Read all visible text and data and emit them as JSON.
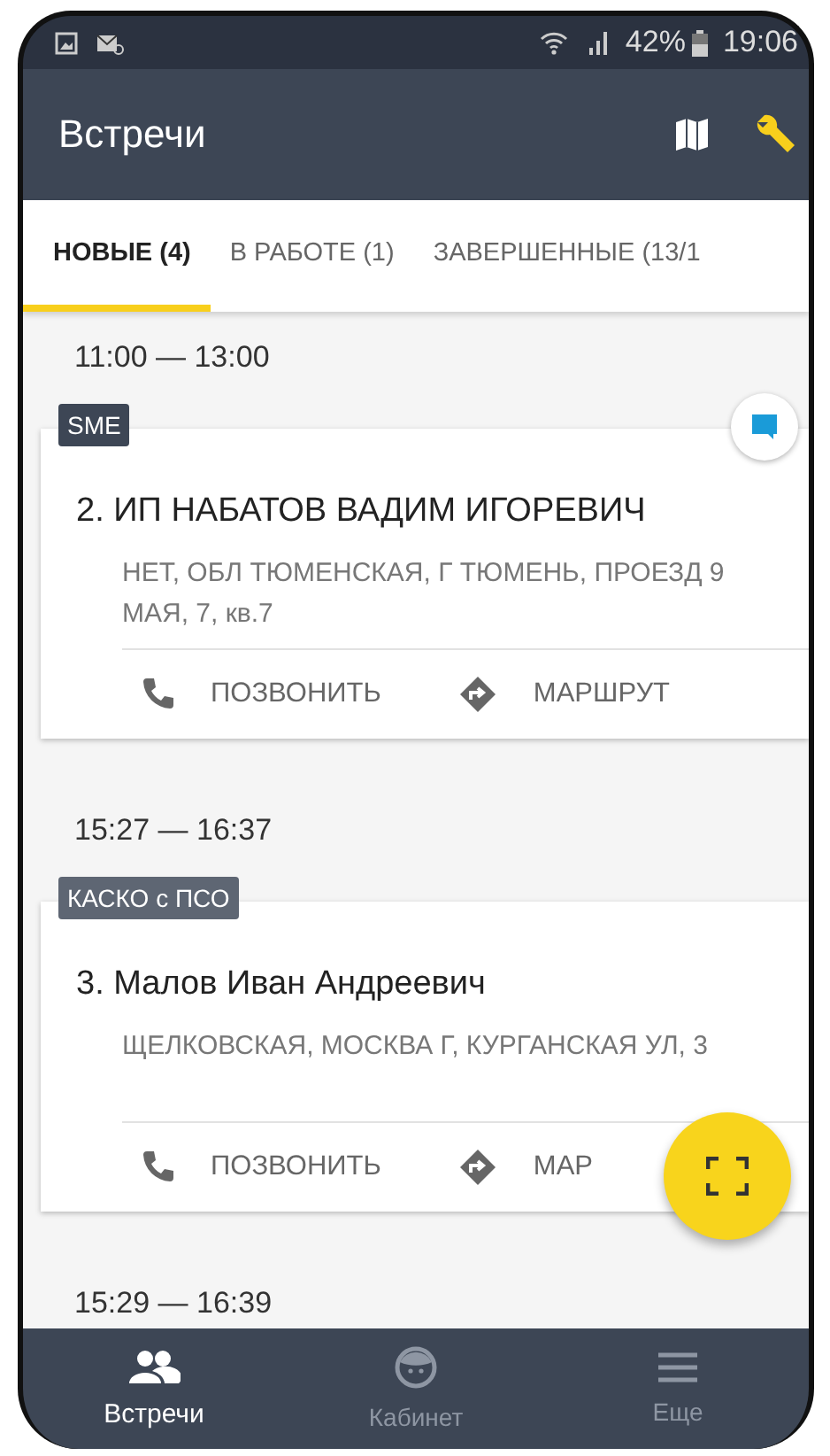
{
  "status_bar": {
    "battery": "42%",
    "time": "19:06"
  },
  "app_bar": {
    "title": "Встречи"
  },
  "tabs": [
    {
      "label": "НОВЫЕ (4)",
      "selected": true
    },
    {
      "label": "В РАБОТЕ (1)",
      "selected": false
    },
    {
      "label": "ЗАВЕРШЕННЫЕ (13/1",
      "selected": false
    }
  ],
  "meetings": [
    {
      "time": "11:00 — 13:00",
      "tag": "SME",
      "chat": true,
      "title": "2. ИП НАБАТОВ ВАДИМ ИГОРЕВИЧ",
      "address": "НЕТ, ОБЛ ТЮМЕНСКАЯ, Г ТЮМЕНЬ, ПРОЕЗД 9 МАЯ, 7, кв.7",
      "actions": [
        {
          "kind": "call",
          "label": "ПОЗВОНИТЬ"
        },
        {
          "kind": "route",
          "label": "МАРШРУТ"
        }
      ]
    },
    {
      "time": "15:27 — 16:37",
      "tag": "КАСКО с ПСО",
      "chat": false,
      "title": "3. Малов Иван Андреевич",
      "address": "ЩЕЛКОВСКАЯ, МОСКВА Г, КУРГАНСКАЯ УЛ, 3",
      "actions": [
        {
          "kind": "call",
          "label": "ПОЗВОНИТЬ"
        },
        {
          "kind": "route",
          "label": "МАР"
        }
      ]
    },
    {
      "time": "15:29 — 16:39"
    }
  ],
  "bottom_nav": [
    {
      "kind": "people",
      "label": "Встречи",
      "selected": true
    },
    {
      "kind": "face",
      "label": "Кабинет",
      "selected": false
    },
    {
      "kind": "menu",
      "label": "Еще",
      "selected": false
    }
  ]
}
